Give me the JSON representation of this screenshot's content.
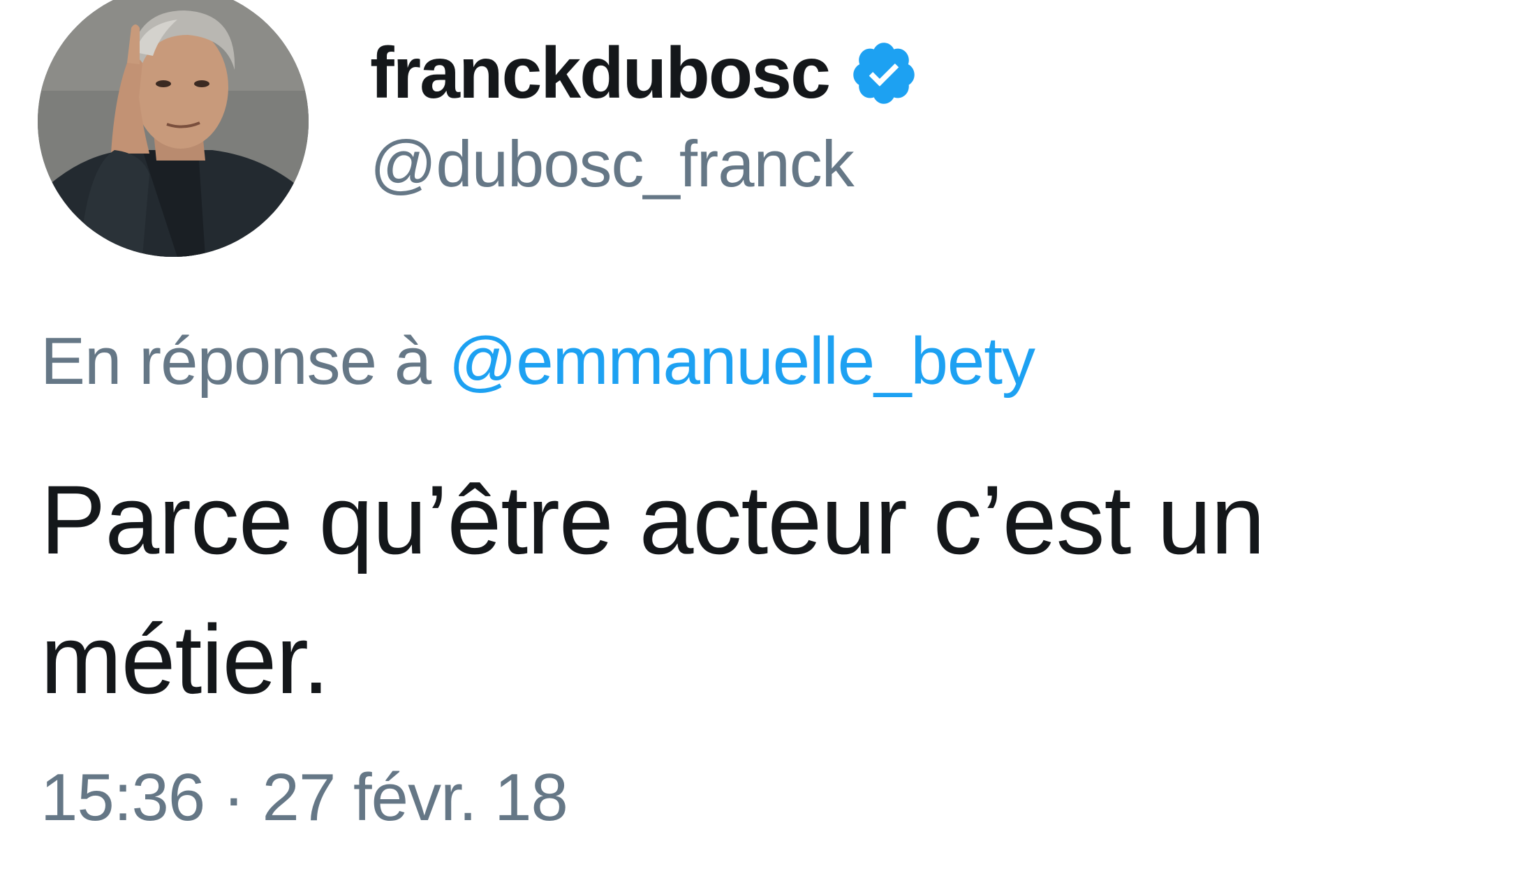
{
  "author": {
    "display_name": "franckdubosc",
    "handle": "@dubosc_franck",
    "verified_icon": "verified-badge-icon",
    "avatar": "profile-photo"
  },
  "reply": {
    "prefix": "En réponse à",
    "mention": "@emmanuelle_bety"
  },
  "tweet": {
    "text": "Parce qu’être acteur c’est un métier.",
    "timestamp": "15:36 · 27 févr. 18"
  },
  "colors": {
    "text_primary": "#14171a",
    "text_secondary": "#657786",
    "link": "#1da1f2",
    "verified": "#1da1f2"
  }
}
